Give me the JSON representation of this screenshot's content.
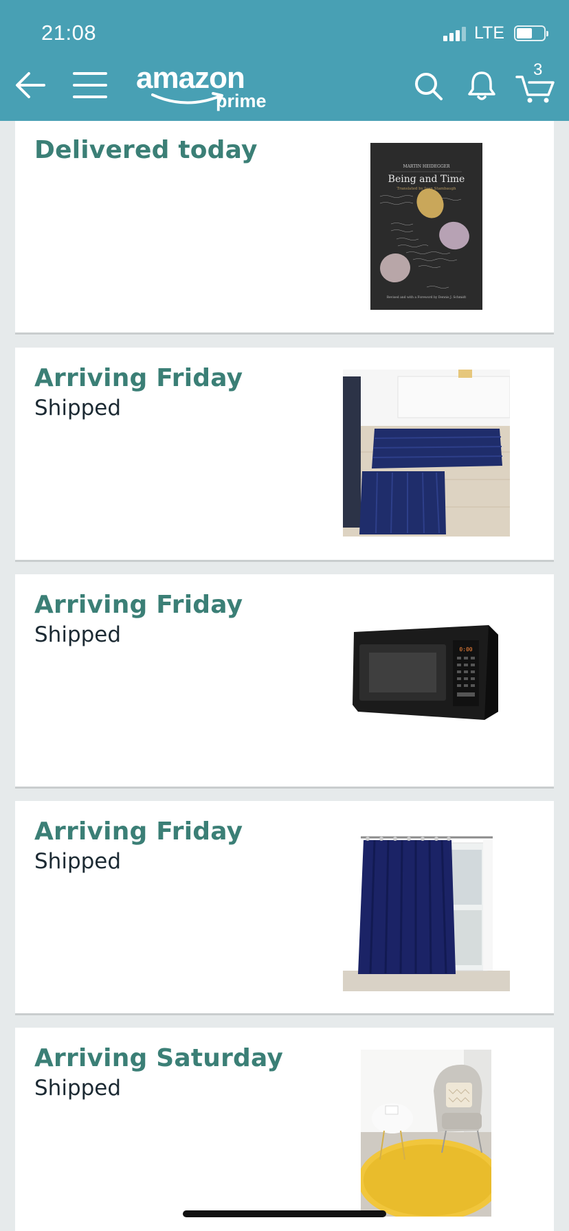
{
  "status_bar": {
    "time": "21:08",
    "network": "LTE"
  },
  "navbar": {
    "logo_text": "amazon",
    "logo_sub": "prime",
    "cart_count": "3",
    "icons": [
      "back-arrow-icon",
      "menu-icon",
      "search-icon",
      "bell-icon",
      "cart-icon"
    ]
  },
  "orders": [
    {
      "title": "Delivered today",
      "status": "",
      "image": "book-being-and-time"
    },
    {
      "title": "Arriving Friday",
      "status": "Shipped",
      "image": "navy-bath-rugs"
    },
    {
      "title": "Arriving Friday",
      "status": "Shipped",
      "image": "black-microwave"
    },
    {
      "title": "Arriving Friday",
      "status": "Shipped",
      "image": "navy-curtain"
    },
    {
      "title": "Arriving Saturday",
      "status": "Shipped",
      "image": "yellow-round-rug"
    }
  ],
  "book": {
    "author": "MARTIN HEIDEGGER",
    "title": "Being and Time",
    "subtitle": "Translated by Joan Stambaugh",
    "footer": "Revised and with a Foreword by Dennis J. Schmidt"
  },
  "colors": {
    "header": "#48a0b4",
    "title": "#3b7f76",
    "background": "#e6eaeb"
  }
}
